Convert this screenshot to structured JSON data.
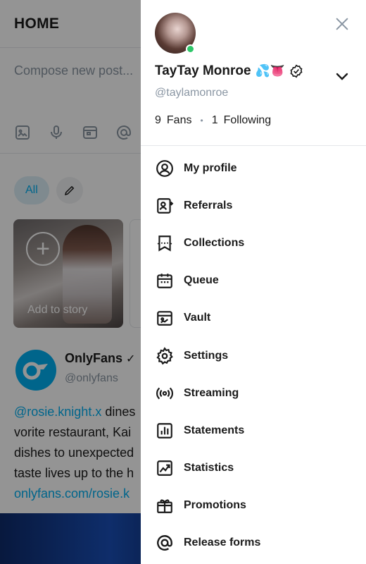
{
  "feed": {
    "title": "HOME",
    "compose_placeholder": "Compose new post...",
    "tools": [
      "image-icon",
      "microphone-icon",
      "vault-icon",
      "at-icon"
    ],
    "chip_all": "All",
    "story_label": "Add to story",
    "post": {
      "author": "OnlyFans",
      "handle": "@onlyfans",
      "lines": [
        {
          "mention": "@rosie.knight.x",
          "text": " dines"
        },
        {
          "text": "vorite restaurant, Kai"
        },
        {
          "text": "dishes to unexpected"
        },
        {
          "text": "taste lives up to the h"
        },
        {
          "link": "onlyfans.com/rosie.k"
        }
      ]
    }
  },
  "drawer": {
    "user_name": "TayTay Monroe",
    "name_emoji": "💦👅",
    "handle": "@taylamonroe",
    "fans_count": "9",
    "fans_label": "Fans",
    "following_count": "1",
    "following_label": "Following",
    "menu": [
      {
        "label": "My profile",
        "icon": "profile-icon"
      },
      {
        "label": "Referrals",
        "icon": "referrals-icon"
      },
      {
        "label": "Collections",
        "icon": "collections-icon"
      },
      {
        "label": "Queue",
        "icon": "calendar-icon"
      },
      {
        "label": "Vault",
        "icon": "vault-icon"
      },
      {
        "label": "Settings",
        "icon": "gear-icon"
      },
      {
        "label": "Streaming",
        "icon": "streaming-icon"
      },
      {
        "label": "Statements",
        "icon": "statements-icon"
      },
      {
        "label": "Statistics",
        "icon": "statistics-icon"
      },
      {
        "label": "Promotions",
        "icon": "gift-icon"
      },
      {
        "label": "Release forms",
        "icon": "at-icon"
      }
    ]
  },
  "colors": {
    "accent": "#00aff0",
    "muted": "#8a96a3",
    "online": "#2ec769"
  }
}
